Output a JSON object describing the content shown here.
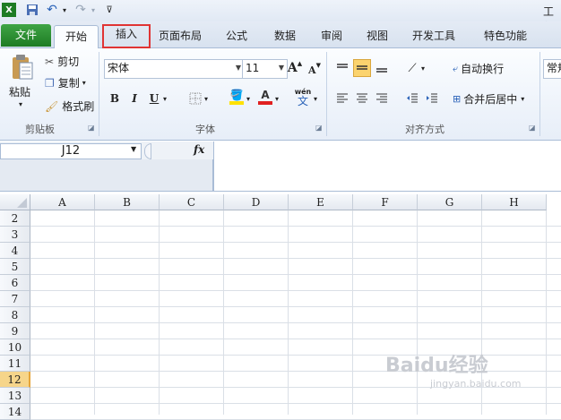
{
  "window": {
    "title_partial": "工作"
  },
  "qat": {
    "save_icon": "save-icon",
    "undo_icon": "undo-icon",
    "redo_icon": "redo-icon"
  },
  "tabs": [
    {
      "label": "文件"
    },
    {
      "label": "开始"
    },
    {
      "label": "插入"
    },
    {
      "label": "页面布局"
    },
    {
      "label": "公式"
    },
    {
      "label": "数据"
    },
    {
      "label": "审阅"
    },
    {
      "label": "视图"
    },
    {
      "label": "开发工具"
    },
    {
      "label": "特色功能"
    }
  ],
  "ribbon": {
    "clipboard": {
      "paste": "粘贴",
      "cut": "剪切",
      "copy": "复制",
      "format_painter": "格式刷",
      "group_label": "剪贴板"
    },
    "font": {
      "font_name": "宋体",
      "font_size": "11",
      "bold": "B",
      "italic": "I",
      "underline": "U",
      "grow": "A",
      "shrink": "A",
      "font_color_letter": "A",
      "wen": "wén",
      "wen_char": "文",
      "group_label": "字体"
    },
    "alignment": {
      "wrap_text": "自动换行",
      "merge_center": "合并后居中",
      "group_label": "对齐方式"
    },
    "number": {
      "format_partial": "常规"
    }
  },
  "formula_bar": {
    "name_box": "J12",
    "fx": "fx",
    "formula": ""
  },
  "sheet": {
    "columns": [
      "A",
      "B",
      "C",
      "D",
      "E",
      "F",
      "G",
      "H"
    ],
    "rows": [
      "2",
      "3",
      "4",
      "5",
      "6",
      "7",
      "8",
      "9",
      "10",
      "11",
      "12",
      "13",
      "14"
    ],
    "selected_row": "12"
  },
  "watermark": {
    "text": "Baidu经验",
    "sub": "jingyan.baidu.com"
  }
}
